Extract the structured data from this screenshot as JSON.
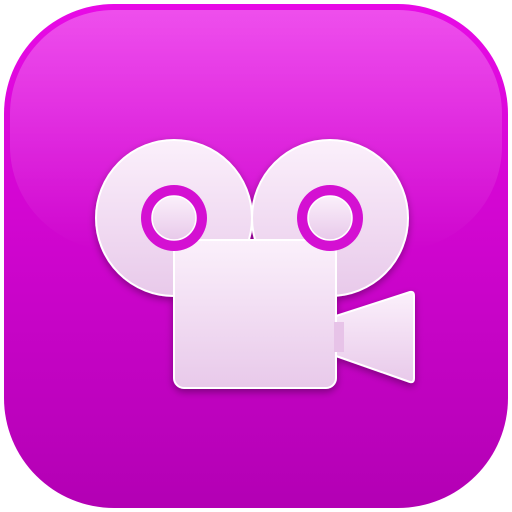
{
  "app_icon": {
    "icon": "movie-camera-icon",
    "colors": {
      "background_top": "#e80ae6",
      "background_bottom": "#b300b4",
      "glyph_light": "#f8e6f7",
      "glyph_shadow": "#e9c2ea",
      "glyph_inner": "#d410d2"
    }
  }
}
